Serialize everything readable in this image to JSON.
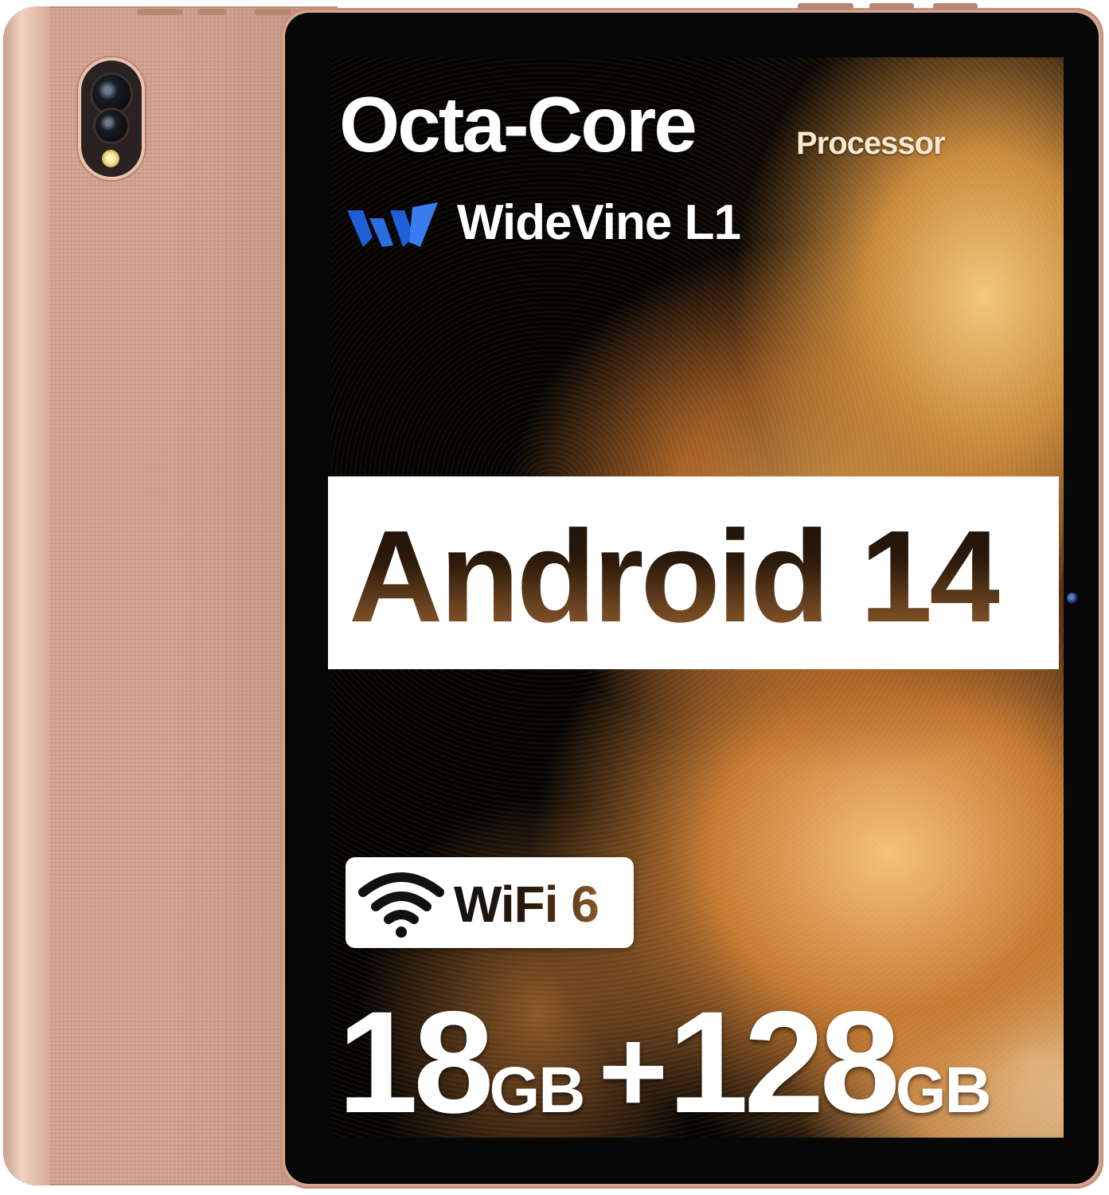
{
  "headline": {
    "title": "Octa-Core",
    "subtitle": "Processor"
  },
  "drm": {
    "label": "WideVine L1",
    "logo_icon": "widevine-logo-icon",
    "logo_color": "#2a6de0"
  },
  "os_banner": {
    "label": "Android 14"
  },
  "wifi": {
    "icon": "wifi-icon",
    "label": "WiFi 6"
  },
  "memory": {
    "ram_value": "18",
    "ram_unit": "GB",
    "plus": "+",
    "storage_value": "128",
    "storage_unit": "GB"
  },
  "colors": {
    "body_rose_gold": "#d7a590",
    "screen_black": "#050403",
    "flower_gold": "#e3a55a"
  }
}
